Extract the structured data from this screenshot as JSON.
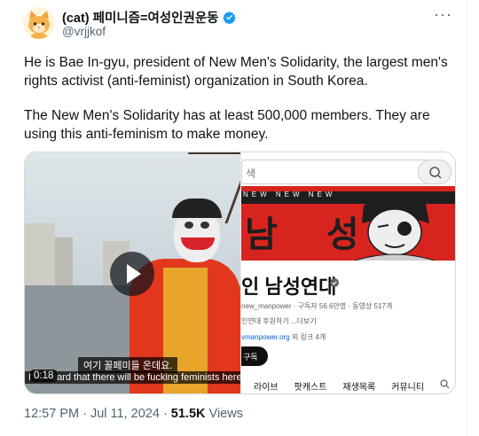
{
  "author": {
    "display_name": "(cat) 페미니즘=여성인권운동",
    "handle": "@vrjjkof",
    "avatar_icon": "cat-avatar-icon",
    "verified_icon": "verified-badge-icon"
  },
  "tweet": {
    "paragraph_1": "He is Bae In-gyu, president of New Men's Solidarity, the largest men's rights activist (anti-feminist) organization in South Korea.",
    "paragraph_2": "The New Men's Solidarity has at least 500,000 members. They are using this anti-feminism to make money."
  },
  "video": {
    "subtitle_korean": "여기 꼴페미들 온데요.",
    "subtitle_english": "I've heard that there will be fucking feminists here.",
    "duration": "0:18"
  },
  "screenshot": {
    "search_placeholder": "색",
    "banner_small_text": "NEW  NEW  NEW",
    "banner_text": "남 성",
    "channel_name": "인 남성연대",
    "meta": "new_manpower · 구독자 56.6만명 · 동영상 517개",
    "description": "인연대 후원하기 ...더보기",
    "link_text": "vmanpower.org",
    "link_suffix": "외 링크 4개",
    "subscribe_label": "구독",
    "tabs": [
      "라이브",
      "팟캐스트",
      "재생목록",
      "커뮤니티"
    ]
  },
  "footer": {
    "time": "12:57 PM",
    "date": "Jul 11, 2024",
    "views_count": "51.5K",
    "views_label": "Views"
  },
  "colors": {
    "accent_blue": "#1d9bf0",
    "secondary_text": "#536471",
    "banner_red": "#d8241e"
  }
}
